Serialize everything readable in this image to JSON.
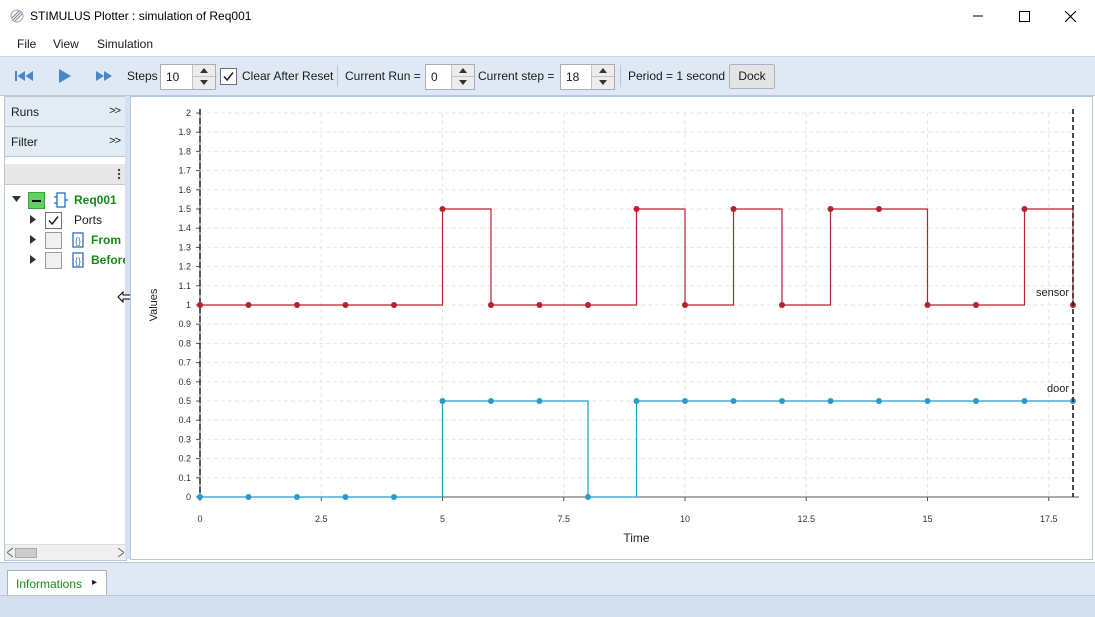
{
  "window": {
    "title": "STIMULUS Plotter : simulation of Req001",
    "controls": [
      "minimize-icon",
      "maximize-icon",
      "close-icon"
    ]
  },
  "menu": {
    "items": [
      "File",
      "View",
      "Simulation"
    ]
  },
  "toolbar": {
    "steps_label": "Steps",
    "steps_value": "10",
    "clear_after_reset_label": "Clear After Reset",
    "clear_after_reset_checked": true,
    "current_run_label": "Current Run =",
    "current_run_value": "0",
    "current_step_label": "Current step =",
    "current_step_value": "18",
    "period_label": "Period = 1 second",
    "dock_label": "Dock",
    "icons": [
      "skip-to-start-icon",
      "play-icon",
      "fast-forward-icon"
    ],
    "accent": "#4a86c8"
  },
  "left_panel": {
    "runs_label": "Runs",
    "filter_label": "Filter",
    "expand_glyph": ">>",
    "tree": [
      {
        "label": "Req001",
        "expanded": true,
        "state": "partial"
      },
      {
        "label": "Ports",
        "checked": true
      },
      {
        "label": "From",
        "checked": false
      },
      {
        "label": "Before",
        "checked": false
      }
    ]
  },
  "chart_data": {
    "type": "line",
    "step": true,
    "xlabel": "Time",
    "ylabel": "Values",
    "xlim": [
      0,
      18
    ],
    "ylim": [
      0,
      2
    ],
    "x_ticks": [
      "0",
      "2.5",
      "5",
      "7.5",
      "10",
      "12.5",
      "15",
      "17.5"
    ],
    "y_ticks": [
      "0",
      "0.1",
      "0.2",
      "0.3",
      "0.4",
      "0.5",
      "0.6",
      "0.7",
      "0.8",
      "0.9",
      "1",
      "1.1",
      "1.2",
      "1.3",
      "1.4",
      "1.5",
      "1.6",
      "1.7",
      "1.8",
      "1.9",
      "2"
    ],
    "grid": true,
    "current_step_marker": 18,
    "series": [
      {
        "name": "sensor",
        "color": "#b5232e",
        "x": [
          0,
          1,
          2,
          3,
          4,
          5,
          6,
          7,
          8,
          9,
          10,
          11,
          12,
          13,
          14,
          15,
          16,
          17,
          18
        ],
        "values": [
          1,
          1,
          1,
          1,
          1,
          1.5,
          1,
          1,
          1,
          1.5,
          1,
          1.5,
          1,
          1.5,
          1.5,
          1,
          1,
          1.5,
          1
        ]
      },
      {
        "name": "door",
        "color": "#2a9bc9",
        "x": [
          0,
          1,
          2,
          3,
          4,
          5,
          6,
          7,
          8,
          9,
          10,
          11,
          12,
          13,
          14,
          15,
          16,
          17,
          18
        ],
        "values": [
          0,
          0,
          0,
          0,
          0,
          0.5,
          0.5,
          0.5,
          0,
          0.5,
          0.5,
          0.5,
          0.5,
          0.5,
          0.5,
          0.5,
          0.5,
          0.5,
          0.5
        ]
      }
    ]
  },
  "bottom": {
    "tab_label": "Informations",
    "tab_arrow": "▸"
  }
}
